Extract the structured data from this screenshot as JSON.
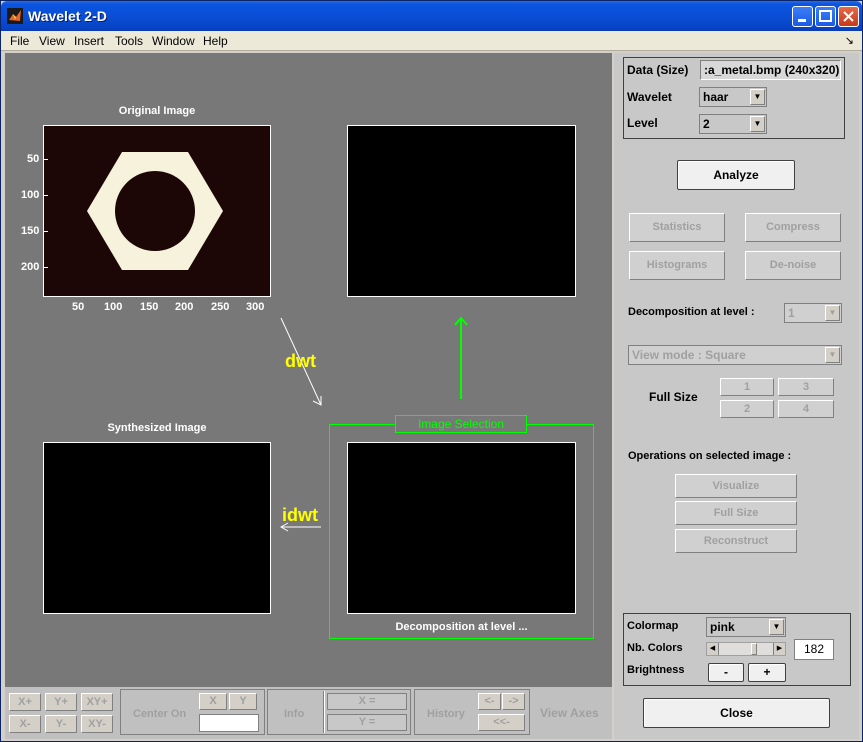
{
  "window": {
    "title": "Wavelet 2-D"
  },
  "menu": [
    "File",
    "View",
    "Insert",
    "Tools",
    "Window",
    "Help"
  ],
  "plots": {
    "original": {
      "title": "Original Image",
      "yticks": [
        "50",
        "100",
        "150",
        "200"
      ],
      "xticks": [
        "50",
        "100",
        "150",
        "200",
        "250",
        "300"
      ]
    },
    "synthesized": {
      "title": "Synthesized Image"
    },
    "decomposition": {
      "caption": "Decomposition at level ..."
    }
  },
  "annotations": {
    "dwt": "dwt",
    "idwt": "idwt",
    "image_selection": "Image Selection"
  },
  "right": {
    "data_label": "Data  (Size)",
    "data_value": ":a_metal.bmp  (240x320)",
    "wavelet_label": "Wavelet",
    "wavelet_value": "haar",
    "level_label": "Level",
    "level_value": "2",
    "analyze": "Analyze",
    "statistics": "Statistics",
    "compress": "Compress",
    "histograms": "Histograms",
    "denoise": "De-noise",
    "decomp_label": "Decomposition at level :",
    "decomp_value": "1",
    "view_mode": "View mode : Square",
    "full_size_label": "Full Size",
    "fs": [
      "1",
      "3",
      "2",
      "4"
    ],
    "ops_label": "Operations on selected image :",
    "visualize": "Visualize",
    "full_size": "Full Size",
    "reconstruct": "Reconstruct",
    "colormap_label": "Colormap",
    "colormap_value": "pink",
    "nb_colors_label": "Nb. Colors",
    "nb_colors_value": "182",
    "brightness_label": "Brightness",
    "minus": "-",
    "plus": "+",
    "close": "Close"
  },
  "bottom": {
    "xplus": "X+",
    "yplus": "Y+",
    "xyplus": "XY+",
    "xminus": "X-",
    "yminus": "Y-",
    "xyminus": "XY-",
    "center_on": "Center On",
    "x": "X",
    "y": "Y",
    "info": "Info",
    "x_eq": "X =",
    "y_eq": "Y =",
    "history": "History",
    "back": "<-",
    "fwd": "->",
    "reset": "<<-",
    "view_axes": "View Axes"
  }
}
